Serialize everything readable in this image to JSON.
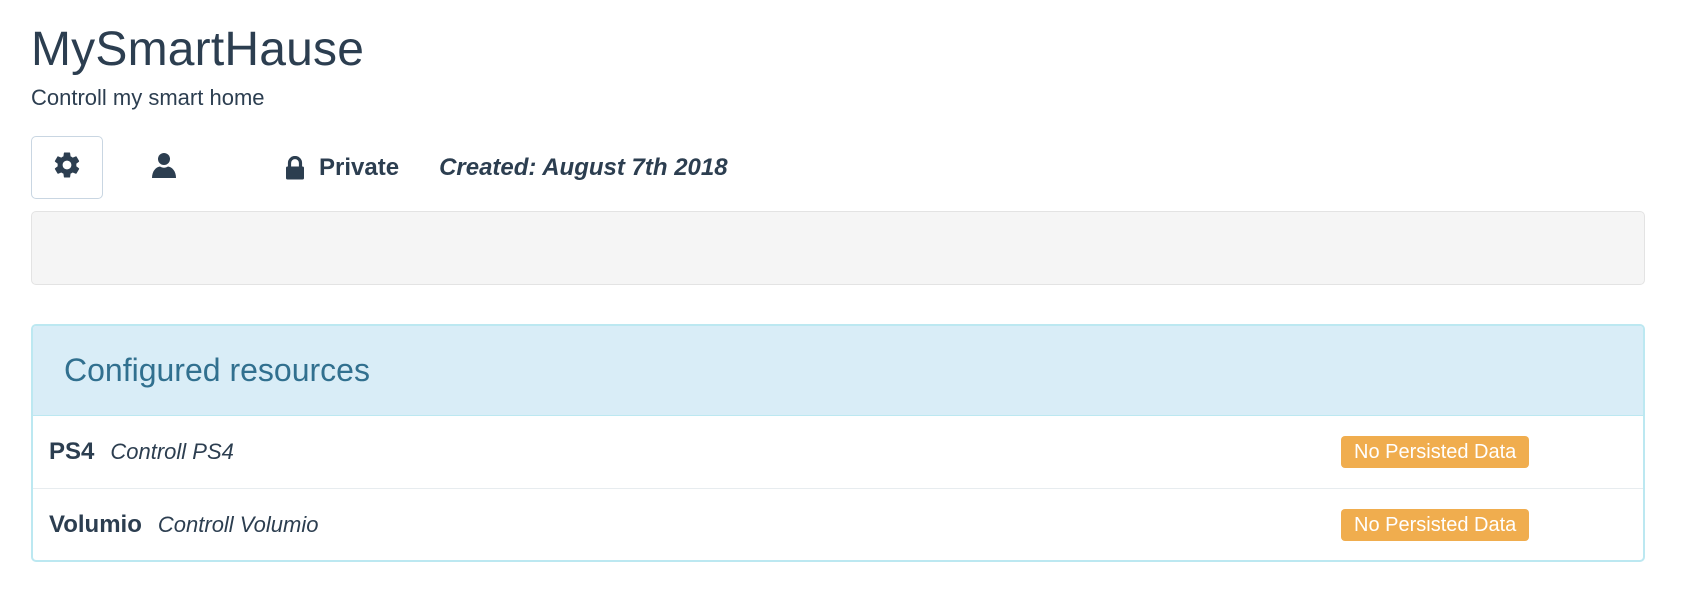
{
  "header": {
    "title": "MySmartHause",
    "subtitle": "Controll my smart home"
  },
  "toolbar": {
    "settings_icon": "gear-icon",
    "user_icon": "user-icon",
    "lock_icon": "lock-icon",
    "privacy_label": "Private",
    "created_label": "Created: August 7th 2018"
  },
  "resources_panel": {
    "title": "Configured resources",
    "items": [
      {
        "name": "PS4",
        "description": "Controll PS4",
        "status": "No Persisted Data"
      },
      {
        "name": "Volumio",
        "description": "Controll Volumio",
        "status": "No Persisted Data"
      }
    ]
  },
  "colors": {
    "text": "#2c3e50",
    "panel_heading_bg": "#d9edf7",
    "panel_heading_text": "#31708f",
    "panel_border": "#bce8f1",
    "badge_warning": "#f0ad4e",
    "well_bg": "#f5f5f5"
  }
}
